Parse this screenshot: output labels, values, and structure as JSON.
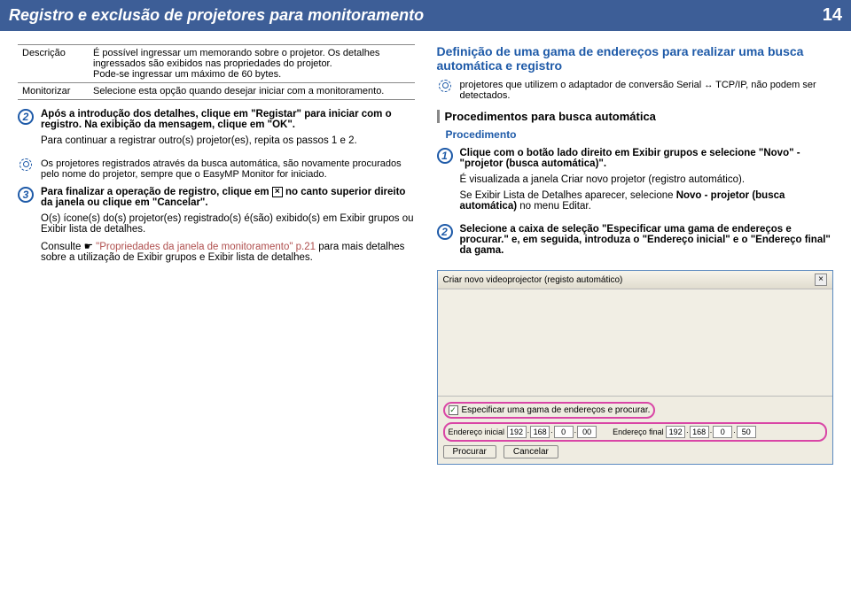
{
  "header": {
    "title": "Registro e exclusão de projetores para monitoramento",
    "page": "14"
  },
  "tbl": {
    "r1l": "Descrição",
    "r1r_a": "É possível ingressar um memorando sobre o projetor. Os detalhes ingressados são exibidos nas propriedades do projetor.",
    "r1r_b": "Pode-se ingressar um máximo de 60 bytes.",
    "r2l": "Monitorizar",
    "r2r": "Selecione esta opção quando desejar iniciar com a monitoramento."
  },
  "left": {
    "s2a": "Após a introdução dos detalhes, clique em \"Registar\" para iniciar com o registro. Na exibição da mensagem, clique em \"OK\".",
    "s2b": "Para continuar a registrar outro(s) projetor(es), repita os passos 1 e 2.",
    "tip1": "Os projetores registrados através da busca automática, são novamente procurados pelo nome do projetor, sempre que o EasyMP Monitor for iniciado.",
    "s3a_pre": "Para finalizar a operação de registro, clique em ",
    "s3a_post": " no canto superior direito da janela ou clique em \"Cancelar\".",
    "s3b": "O(s) ícone(s) do(s) projetor(es) registrado(s) é(são) exibido(s) em Exibir grupos ou Exibir lista de detalhes.",
    "s3c_pre": "Consulte ",
    "s3c_link1": "\"Propriedades da janela de monitoramento\"",
    "s3c_link2": " p.21",
    "s3c_post": " para mais detalhes sobre a utilização de Exibir grupos e Exibir lista de detalhes."
  },
  "right": {
    "h2": "Definição de uma gama de endereços para realizar uma busca automática e registro",
    "tip_pre": "projetores que utilizem o adaptador de conversão Serial ",
    "tip_post": " TCP/IP, não podem ser detectados.",
    "h3": "Procedimentos para busca automática",
    "proc": "Procedimento",
    "s1a": "Clique com o botão lado direito em Exibir grupos e selecione \"Novo\" - \"projetor (busca automática)\".",
    "s1b": "É visualizada a janela Criar novo projetor (registro automático).",
    "s1c_pre": "Se Exibir Lista de Detalhes aparecer, selecione ",
    "s1c_b": "Novo - projetor (busca automática)",
    "s1c_post": " no menu Editar.",
    "s2": "Selecione a caixa de seleção \"Especificar uma gama de endereços e procurar.\" e, em seguida, introduza o \"Endereço inicial\" e o \"Endereço final\" da gama."
  },
  "scr": {
    "title": "Criar novo videoprojector (registo automático)",
    "chk_label": "Especificar uma gama de endereços e procurar.",
    "lbl_ini": "Endereço inicial",
    "lbl_fin": "Endereço final",
    "ip1": [
      "192",
      "168",
      "0",
      "00"
    ],
    "ip2": [
      "192",
      "168",
      "0",
      "50"
    ],
    "btn1": "Procurar",
    "btn2": "Cancelar"
  }
}
